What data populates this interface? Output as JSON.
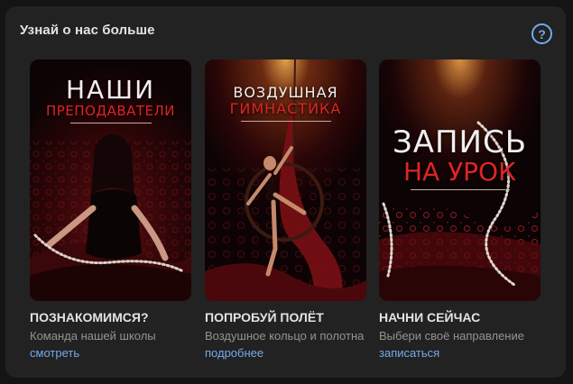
{
  "widget": {
    "title": "Узнай о нас больше",
    "help_symbol": "?"
  },
  "cards": [
    {
      "poster_title": "НАШИ",
      "poster_subtitle": "ПРЕПОДАВАТЕЛИ",
      "title": "ПОЗНАКОМИМСЯ?",
      "description": "Команда нашей школы",
      "link": "смотреть"
    },
    {
      "poster_title": "ВОЗДУШНАЯ",
      "poster_subtitle": "ГИМНАСТИКА",
      "title": "ПОПРОБУЙ ПОЛЁТ",
      "description": "Воздушное кольцо и полотна",
      "link": "подробнее"
    },
    {
      "poster_title": "ЗАПИСЬ",
      "poster_subtitle": "НА УРОК",
      "title": "НАЧНИ СЕЙЧАС",
      "description": "Выбери своё направление",
      "link": "записаться"
    }
  ],
  "colors": {
    "background": "#222222",
    "link": "#71aaeb",
    "poster_accent": "#e02424"
  }
}
